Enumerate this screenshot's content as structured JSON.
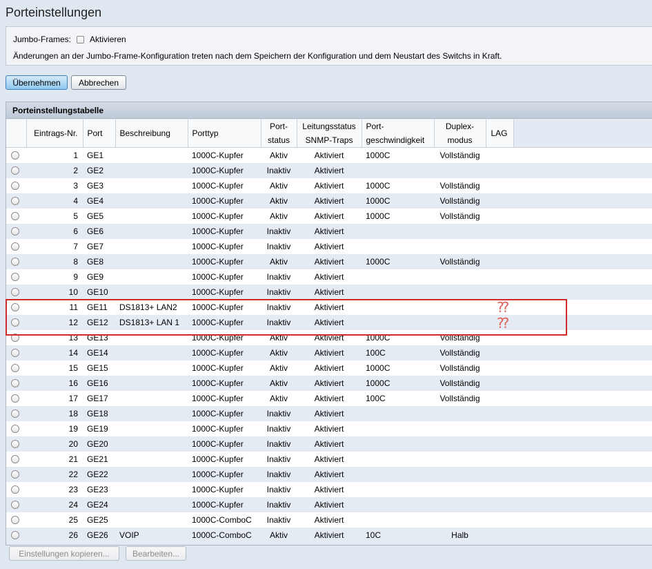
{
  "page": {
    "title": "Porteinstellungen"
  },
  "jumbo": {
    "label": "Jumbo-Frames:",
    "checkbox_label": "Aktivieren",
    "checked": false,
    "note": "Änderungen an der Jumbo-Frame-Konfiguration treten nach dem Speichern der Konfiguration und dem Neustart des Switchs in Kraft."
  },
  "buttons": {
    "apply": "Übernehmen",
    "cancel": "Abbrechen",
    "copy_settings": "Einstellungen kopieren...",
    "edit": "Bearbeiten..."
  },
  "table": {
    "title": "Porteinstellungstabelle",
    "headers": {
      "entry_no": "Eintrags-Nr.",
      "port": "Port",
      "description": "Beschreibung",
      "port_type": "Porttyp",
      "port_status_1": "Port-",
      "port_status_2": "status",
      "link_status_1": "Leitungsstatus",
      "link_status_2": "SNMP-Traps",
      "port_speed_1": "Port-",
      "port_speed_2": "geschwindigkeit",
      "duplex_1": "Duplex-",
      "duplex_2": "modus",
      "lag": "LAG"
    },
    "rows": [
      {
        "n": "1",
        "port": "GE1",
        "desc": "",
        "type": "1000C-Kupfer",
        "status": "Aktiv",
        "trap": "Aktiviert",
        "speed": "1000C",
        "duplex": "Vollständig",
        "lag": ""
      },
      {
        "n": "2",
        "port": "GE2",
        "desc": "",
        "type": "1000C-Kupfer",
        "status": "Inaktiv",
        "trap": "Aktiviert",
        "speed": "",
        "duplex": "",
        "lag": ""
      },
      {
        "n": "3",
        "port": "GE3",
        "desc": "",
        "type": "1000C-Kupfer",
        "status": "Aktiv",
        "trap": "Aktiviert",
        "speed": "1000C",
        "duplex": "Vollständig",
        "lag": ""
      },
      {
        "n": "4",
        "port": "GE4",
        "desc": "",
        "type": "1000C-Kupfer",
        "status": "Aktiv",
        "trap": "Aktiviert",
        "speed": "1000C",
        "duplex": "Vollständig",
        "lag": ""
      },
      {
        "n": "5",
        "port": "GE5",
        "desc": "",
        "type": "1000C-Kupfer",
        "status": "Aktiv",
        "trap": "Aktiviert",
        "speed": "1000C",
        "duplex": "Vollständig",
        "lag": ""
      },
      {
        "n": "6",
        "port": "GE6",
        "desc": "",
        "type": "1000C-Kupfer",
        "status": "Inaktiv",
        "trap": "Aktiviert",
        "speed": "",
        "duplex": "",
        "lag": ""
      },
      {
        "n": "7",
        "port": "GE7",
        "desc": "",
        "type": "1000C-Kupfer",
        "status": "Inaktiv",
        "trap": "Aktiviert",
        "speed": "",
        "duplex": "",
        "lag": ""
      },
      {
        "n": "8",
        "port": "GE8",
        "desc": "",
        "type": "1000C-Kupfer",
        "status": "Aktiv",
        "trap": "Aktiviert",
        "speed": "1000C",
        "duplex": "Vollständig",
        "lag": ""
      },
      {
        "n": "9",
        "port": "GE9",
        "desc": "",
        "type": "1000C-Kupfer",
        "status": "Inaktiv",
        "trap": "Aktiviert",
        "speed": "",
        "duplex": "",
        "lag": ""
      },
      {
        "n": "10",
        "port": "GE10",
        "desc": "",
        "type": "1000C-Kupfer",
        "status": "Inaktiv",
        "trap": "Aktiviert",
        "speed": "",
        "duplex": "",
        "lag": ""
      },
      {
        "n": "11",
        "port": "GE11",
        "desc": "DS1813+ LAN2",
        "type": "1000C-Kupfer",
        "status": "Inaktiv",
        "trap": "Aktiviert",
        "speed": "",
        "duplex": "",
        "lag": ""
      },
      {
        "n": "12",
        "port": "GE12",
        "desc": "DS1813+ LAN 1",
        "type": "1000C-Kupfer",
        "status": "Inaktiv",
        "trap": "Aktiviert",
        "speed": "",
        "duplex": "",
        "lag": ""
      },
      {
        "n": "13",
        "port": "GE13",
        "desc": "",
        "type": "1000C-Kupfer",
        "status": "Aktiv",
        "trap": "Aktiviert",
        "speed": "1000C",
        "duplex": "Vollständig",
        "lag": ""
      },
      {
        "n": "14",
        "port": "GE14",
        "desc": "",
        "type": "1000C-Kupfer",
        "status": "Aktiv",
        "trap": "Aktiviert",
        "speed": "100C",
        "duplex": "Vollständig",
        "lag": ""
      },
      {
        "n": "15",
        "port": "GE15",
        "desc": "",
        "type": "1000C-Kupfer",
        "status": "Aktiv",
        "trap": "Aktiviert",
        "speed": "1000C",
        "duplex": "Vollständig",
        "lag": ""
      },
      {
        "n": "16",
        "port": "GE16",
        "desc": "",
        "type": "1000C-Kupfer",
        "status": "Aktiv",
        "trap": "Aktiviert",
        "speed": "1000C",
        "duplex": "Vollständig",
        "lag": ""
      },
      {
        "n": "17",
        "port": "GE17",
        "desc": "",
        "type": "1000C-Kupfer",
        "status": "Aktiv",
        "trap": "Aktiviert",
        "speed": "100C",
        "duplex": "Vollständig",
        "lag": ""
      },
      {
        "n": "18",
        "port": "GE18",
        "desc": "",
        "type": "1000C-Kupfer",
        "status": "Inaktiv",
        "trap": "Aktiviert",
        "speed": "",
        "duplex": "",
        "lag": ""
      },
      {
        "n": "19",
        "port": "GE19",
        "desc": "",
        "type": "1000C-Kupfer",
        "status": "Inaktiv",
        "trap": "Aktiviert",
        "speed": "",
        "duplex": "",
        "lag": ""
      },
      {
        "n": "20",
        "port": "GE20",
        "desc": "",
        "type": "1000C-Kupfer",
        "status": "Inaktiv",
        "trap": "Aktiviert",
        "speed": "",
        "duplex": "",
        "lag": ""
      },
      {
        "n": "21",
        "port": "GE21",
        "desc": "",
        "type": "1000C-Kupfer",
        "status": "Inaktiv",
        "trap": "Aktiviert",
        "speed": "",
        "duplex": "",
        "lag": ""
      },
      {
        "n": "22",
        "port": "GE22",
        "desc": "",
        "type": "1000C-Kupfer",
        "status": "Inaktiv",
        "trap": "Aktiviert",
        "speed": "",
        "duplex": "",
        "lag": ""
      },
      {
        "n": "23",
        "port": "GE23",
        "desc": "",
        "type": "1000C-Kupfer",
        "status": "Inaktiv",
        "trap": "Aktiviert",
        "speed": "",
        "duplex": "",
        "lag": ""
      },
      {
        "n": "24",
        "port": "GE24",
        "desc": "",
        "type": "1000C-Kupfer",
        "status": "Inaktiv",
        "trap": "Aktiviert",
        "speed": "",
        "duplex": "",
        "lag": ""
      },
      {
        "n": "25",
        "port": "GE25",
        "desc": "",
        "type": "1000C-ComboC",
        "status": "Inaktiv",
        "trap": "Aktiviert",
        "speed": "",
        "duplex": "",
        "lag": ""
      },
      {
        "n": "26",
        "port": "GE26",
        "desc": "VOIP",
        "type": "1000C-ComboC",
        "status": "Aktiv",
        "trap": "Aktiviert",
        "speed": "10C",
        "duplex": "Halb",
        "lag": ""
      }
    ]
  },
  "annotation": {
    "mark_1": "??",
    "mark_2": "??",
    "color": "#d02a2a"
  }
}
